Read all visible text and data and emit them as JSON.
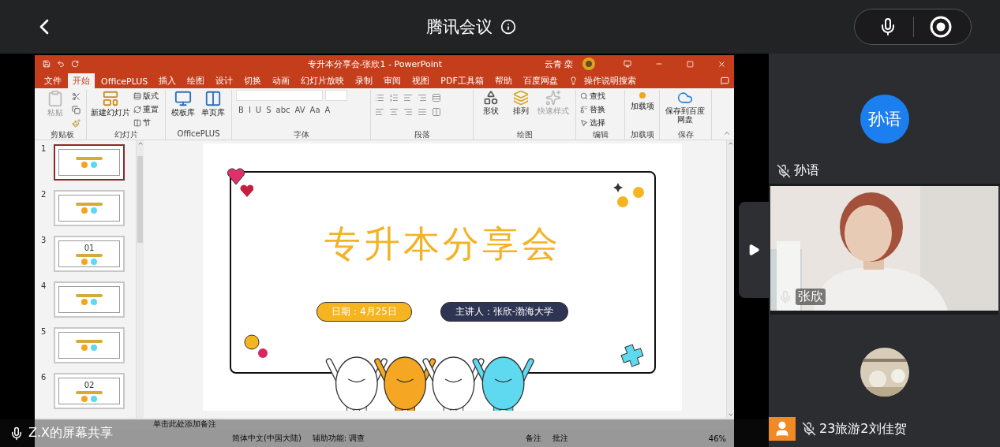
{
  "meeting": {
    "title": "腾讯会议"
  },
  "ppt": {
    "title": "专升本分享会-张欣1 - PowerPoint",
    "user": "云青 栾",
    "tabs": [
      {
        "label": "文件",
        "selected": false
      },
      {
        "label": "开始",
        "selected": true
      },
      {
        "label": "OfficePLUS",
        "selected": false
      },
      {
        "label": "插入",
        "selected": false
      },
      {
        "label": "绘图",
        "selected": false
      },
      {
        "label": "设计",
        "selected": false
      },
      {
        "label": "切换",
        "selected": false
      },
      {
        "label": "动画",
        "selected": false
      },
      {
        "label": "幻灯片放映",
        "selected": false
      },
      {
        "label": "录制",
        "selected": false
      },
      {
        "label": "审阅",
        "selected": false
      },
      {
        "label": "视图",
        "selected": false
      },
      {
        "label": "PDF工具箱",
        "selected": false
      },
      {
        "label": "帮助",
        "selected": false
      },
      {
        "label": "百度网盘",
        "selected": false
      }
    ],
    "search": "操作说明搜索",
    "groups": [
      {
        "kind": "buttons",
        "label": "剪贴板",
        "items": [
          {
            "kind": "paste",
            "label": "粘贴",
            "disabled": true
          },
          {
            "kind": "cut",
            "disabled": false
          },
          {
            "kind": "copy",
            "disabled": false
          },
          {
            "kind": "brush",
            "disabled": false
          }
        ]
      },
      {
        "kind": "buttons",
        "label": "幻灯片",
        "items": [
          {
            "kind": "new-slide",
            "label": "新建幻灯片",
            "disabled": false
          },
          {
            "kind": "layout",
            "label": "版式",
            "disabled": false
          },
          {
            "kind": "reset",
            "label": "重置",
            "disabled": false
          },
          {
            "kind": "section",
            "label": "节",
            "disabled": false
          }
        ]
      },
      {
        "kind": "buttons",
        "label": "OfficePLUS",
        "items": [
          {
            "kind": "template",
            "label": "模板库",
            "disabled": false
          },
          {
            "kind": "page",
            "label": "单页库",
            "disabled": false
          }
        ]
      },
      {
        "kind": "font",
        "label": "字体",
        "glyphs": [
          "B",
          "I",
          "U",
          "S",
          "abc",
          "AV",
          "Aa",
          "A"
        ]
      },
      {
        "kind": "paragraph",
        "label": "段落"
      },
      {
        "kind": "buttons",
        "label": "绘图",
        "items": [
          {
            "kind": "shape",
            "label": "形状",
            "disabled": false
          },
          {
            "kind": "arrange",
            "label": "排列",
            "disabled": false
          },
          {
            "kind": "style",
            "label": "快速样式",
            "disabled": true
          }
        ]
      },
      {
        "kind": "buttons",
        "label": "编辑",
        "items": [
          {
            "kind": "find",
            "label": "查找",
            "disabled": false
          },
          {
            "kind": "replace",
            "label": "替换",
            "disabled": false
          },
          {
            "kind": "select",
            "label": "选择",
            "disabled": false
          }
        ]
      },
      {
        "kind": "buttons",
        "label": "加载项",
        "items": [
          {
            "kind": "addin",
            "label": "加载项",
            "disabled": false
          }
        ]
      },
      {
        "kind": "buttons",
        "label": "保存",
        "items": [
          {
            "kind": "cloud",
            "label": "保存到百度网盘",
            "disabled": false
          }
        ]
      }
    ],
    "thumbnails": [
      {
        "number": "1",
        "selected": true
      },
      {
        "number": "2",
        "selected": false
      },
      {
        "number": "3",
        "selected": false,
        "heading": "01"
      },
      {
        "number": "4",
        "selected": false
      },
      {
        "number": "5",
        "selected": false
      },
      {
        "number": "6",
        "selected": false,
        "heading": "02"
      }
    ],
    "slide": {
      "title": "专升本分享会",
      "date": "日期：4月25日",
      "speaker": "主讲人：张欣-渤海大学"
    },
    "notes_placeholder": "单击此处添加备注",
    "status": {
      "language": "简体中文(中国大陆)",
      "accessibility": "辅助功能: 调查",
      "notes": "备注",
      "comments": "批注",
      "zoom": "46%"
    }
  },
  "share_label": "Z.X的屏幕共享",
  "participants": [
    {
      "kind": "avatar",
      "avatar_text": "孙语",
      "name": "孙语",
      "muted": true,
      "badge": false
    },
    {
      "kind": "video",
      "name": "张欣",
      "muted": false,
      "badge": false
    },
    {
      "name": "23旅游2刘佳贺",
      "muted": true,
      "badge": true
    }
  ]
}
